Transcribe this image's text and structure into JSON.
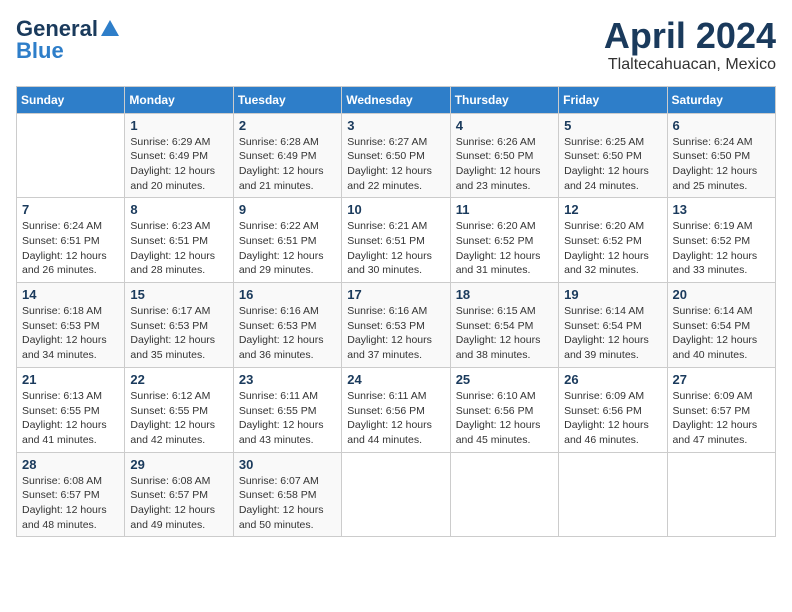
{
  "header": {
    "logo_general": "General",
    "logo_blue": "Blue",
    "month_title": "April 2024",
    "location": "Tlaltecahuacan, Mexico"
  },
  "days_of_week": [
    "Sunday",
    "Monday",
    "Tuesday",
    "Wednesday",
    "Thursday",
    "Friday",
    "Saturday"
  ],
  "weeks": [
    [
      {
        "day": "",
        "info": ""
      },
      {
        "day": "1",
        "info": "Sunrise: 6:29 AM\nSunset: 6:49 PM\nDaylight: 12 hours\nand 20 minutes."
      },
      {
        "day": "2",
        "info": "Sunrise: 6:28 AM\nSunset: 6:49 PM\nDaylight: 12 hours\nand 21 minutes."
      },
      {
        "day": "3",
        "info": "Sunrise: 6:27 AM\nSunset: 6:50 PM\nDaylight: 12 hours\nand 22 minutes."
      },
      {
        "day": "4",
        "info": "Sunrise: 6:26 AM\nSunset: 6:50 PM\nDaylight: 12 hours\nand 23 minutes."
      },
      {
        "day": "5",
        "info": "Sunrise: 6:25 AM\nSunset: 6:50 PM\nDaylight: 12 hours\nand 24 minutes."
      },
      {
        "day": "6",
        "info": "Sunrise: 6:24 AM\nSunset: 6:50 PM\nDaylight: 12 hours\nand 25 minutes."
      }
    ],
    [
      {
        "day": "7",
        "info": "Sunrise: 6:24 AM\nSunset: 6:51 PM\nDaylight: 12 hours\nand 26 minutes."
      },
      {
        "day": "8",
        "info": "Sunrise: 6:23 AM\nSunset: 6:51 PM\nDaylight: 12 hours\nand 28 minutes."
      },
      {
        "day": "9",
        "info": "Sunrise: 6:22 AM\nSunset: 6:51 PM\nDaylight: 12 hours\nand 29 minutes."
      },
      {
        "day": "10",
        "info": "Sunrise: 6:21 AM\nSunset: 6:51 PM\nDaylight: 12 hours\nand 30 minutes."
      },
      {
        "day": "11",
        "info": "Sunrise: 6:20 AM\nSunset: 6:52 PM\nDaylight: 12 hours\nand 31 minutes."
      },
      {
        "day": "12",
        "info": "Sunrise: 6:20 AM\nSunset: 6:52 PM\nDaylight: 12 hours\nand 32 minutes."
      },
      {
        "day": "13",
        "info": "Sunrise: 6:19 AM\nSunset: 6:52 PM\nDaylight: 12 hours\nand 33 minutes."
      }
    ],
    [
      {
        "day": "14",
        "info": "Sunrise: 6:18 AM\nSunset: 6:53 PM\nDaylight: 12 hours\nand 34 minutes."
      },
      {
        "day": "15",
        "info": "Sunrise: 6:17 AM\nSunset: 6:53 PM\nDaylight: 12 hours\nand 35 minutes."
      },
      {
        "day": "16",
        "info": "Sunrise: 6:16 AM\nSunset: 6:53 PM\nDaylight: 12 hours\nand 36 minutes."
      },
      {
        "day": "17",
        "info": "Sunrise: 6:16 AM\nSunset: 6:53 PM\nDaylight: 12 hours\nand 37 minutes."
      },
      {
        "day": "18",
        "info": "Sunrise: 6:15 AM\nSunset: 6:54 PM\nDaylight: 12 hours\nand 38 minutes."
      },
      {
        "day": "19",
        "info": "Sunrise: 6:14 AM\nSunset: 6:54 PM\nDaylight: 12 hours\nand 39 minutes."
      },
      {
        "day": "20",
        "info": "Sunrise: 6:14 AM\nSunset: 6:54 PM\nDaylight: 12 hours\nand 40 minutes."
      }
    ],
    [
      {
        "day": "21",
        "info": "Sunrise: 6:13 AM\nSunset: 6:55 PM\nDaylight: 12 hours\nand 41 minutes."
      },
      {
        "day": "22",
        "info": "Sunrise: 6:12 AM\nSunset: 6:55 PM\nDaylight: 12 hours\nand 42 minutes."
      },
      {
        "day": "23",
        "info": "Sunrise: 6:11 AM\nSunset: 6:55 PM\nDaylight: 12 hours\nand 43 minutes."
      },
      {
        "day": "24",
        "info": "Sunrise: 6:11 AM\nSunset: 6:56 PM\nDaylight: 12 hours\nand 44 minutes."
      },
      {
        "day": "25",
        "info": "Sunrise: 6:10 AM\nSunset: 6:56 PM\nDaylight: 12 hours\nand 45 minutes."
      },
      {
        "day": "26",
        "info": "Sunrise: 6:09 AM\nSunset: 6:56 PM\nDaylight: 12 hours\nand 46 minutes."
      },
      {
        "day": "27",
        "info": "Sunrise: 6:09 AM\nSunset: 6:57 PM\nDaylight: 12 hours\nand 47 minutes."
      }
    ],
    [
      {
        "day": "28",
        "info": "Sunrise: 6:08 AM\nSunset: 6:57 PM\nDaylight: 12 hours\nand 48 minutes."
      },
      {
        "day": "29",
        "info": "Sunrise: 6:08 AM\nSunset: 6:57 PM\nDaylight: 12 hours\nand 49 minutes."
      },
      {
        "day": "30",
        "info": "Sunrise: 6:07 AM\nSunset: 6:58 PM\nDaylight: 12 hours\nand 50 minutes."
      },
      {
        "day": "",
        "info": ""
      },
      {
        "day": "",
        "info": ""
      },
      {
        "day": "",
        "info": ""
      },
      {
        "day": "",
        "info": ""
      }
    ]
  ]
}
